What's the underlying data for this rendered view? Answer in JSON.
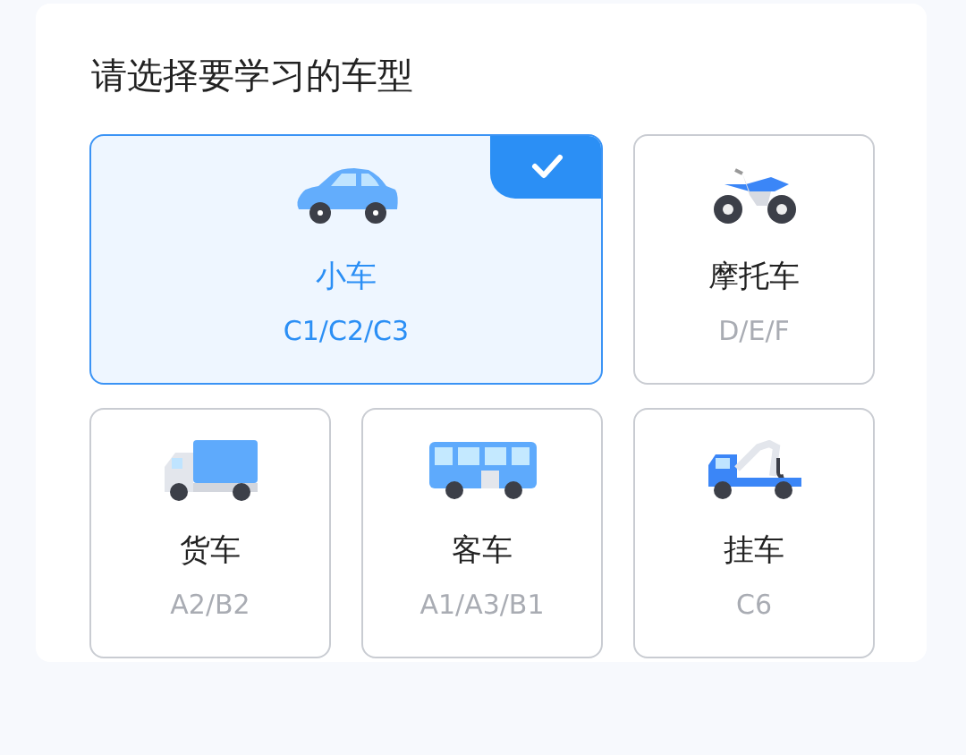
{
  "title": "请选择要学习的车型",
  "vehicles": [
    {
      "kind": "car",
      "name": "小车",
      "codes": "C1/C2/C3",
      "selected": true
    },
    {
      "kind": "motorcycle",
      "name": "摩托车",
      "codes": "D/E/F",
      "selected": false
    },
    {
      "kind": "truck",
      "name": "货车",
      "codes": "A2/B2",
      "selected": false
    },
    {
      "kind": "bus",
      "name": "客车",
      "codes": "A1/A3/B1",
      "selected": false
    },
    {
      "kind": "tow",
      "name": "挂车",
      "codes": "C6",
      "selected": false
    }
  ]
}
